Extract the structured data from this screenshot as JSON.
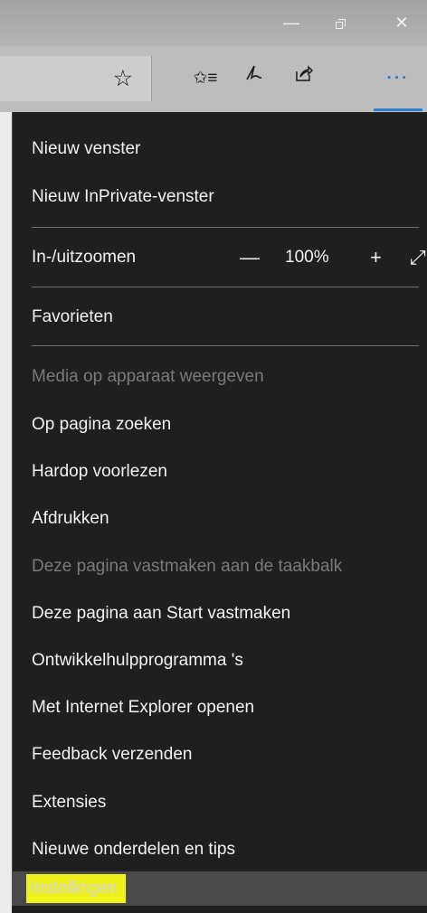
{
  "window": {
    "minimize_glyph": "—",
    "close_glyph": "✕"
  },
  "toolbar": {
    "star_glyph": "☆",
    "hub_glyph": "✩≡",
    "note_glyph": "ℓ",
    "share_glyph": "⇗",
    "more_glyph": "···",
    "accent_color": "#2b7fd0"
  },
  "menu": {
    "items": [
      {
        "label": "Nieuw venster",
        "enabled": true
      },
      {
        "label": "Nieuw InPrivate-venster",
        "enabled": true
      }
    ],
    "zoom": {
      "label": "In-/uitzoomen",
      "minus": "—",
      "value": "100%",
      "plus": "+",
      "fullscreen": "⤢"
    },
    "favorites": "Favorieten",
    "lower_items": [
      {
        "label": "Media op apparaat weergeven",
        "enabled": false
      },
      {
        "label": "Op pagina zoeken",
        "enabled": true
      },
      {
        "label": "Hardop voorlezen",
        "enabled": true
      },
      {
        "label": "Afdrukken",
        "enabled": true
      },
      {
        "label": "Deze pagina vastmaken aan de taakbalk",
        "enabled": false
      },
      {
        "label": "Deze pagina aan Start vastmaken",
        "enabled": true
      },
      {
        "label": "Ontwikkelhulpprogramma 's",
        "enabled": true
      },
      {
        "label": "Met Internet Explorer openen",
        "enabled": true
      },
      {
        "label": "Feedback verzenden",
        "enabled": true
      },
      {
        "label": "Extensies",
        "enabled": true
      },
      {
        "label": "Nieuwe onderdelen en tips",
        "enabled": true
      }
    ],
    "settings": "Instellingen",
    "highlight_color": "#f0f21c"
  }
}
